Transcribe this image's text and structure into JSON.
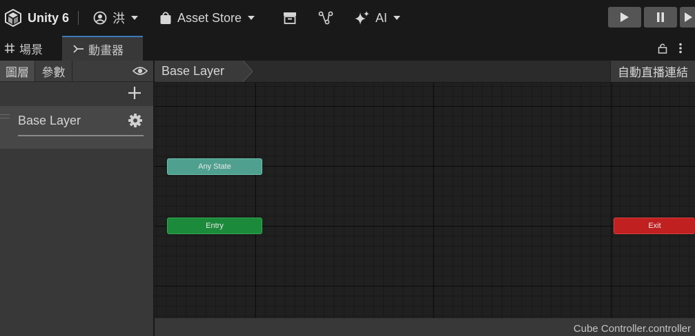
{
  "toolbar": {
    "app_title": "Unity 6",
    "account_label": "洪",
    "asset_store_label": "Asset Store",
    "ai_label": "AI"
  },
  "tabs": [
    {
      "label": "場景"
    },
    {
      "label": "動畫器"
    }
  ],
  "left_panel": {
    "tabs": [
      {
        "label": "圖層"
      },
      {
        "label": "參數"
      }
    ],
    "layers": [
      {
        "label": "Base Layer"
      }
    ]
  },
  "breadcrumb": {
    "label": "Base Layer",
    "auto_live_link_label": "自動直播連結"
  },
  "graph": {
    "nodes": [
      {
        "label": "Any State",
        "color": "#4fa08f"
      },
      {
        "label": "Entry",
        "color": "#1c8a3b"
      },
      {
        "label": "Exit",
        "color": "#c02020"
      }
    ]
  },
  "footer": {
    "file_label": "Cube Controller.controller"
  },
  "colors": {
    "tab_accent": "#3a79bb",
    "panel_bg": "#383838",
    "graph_bg": "#202020"
  }
}
